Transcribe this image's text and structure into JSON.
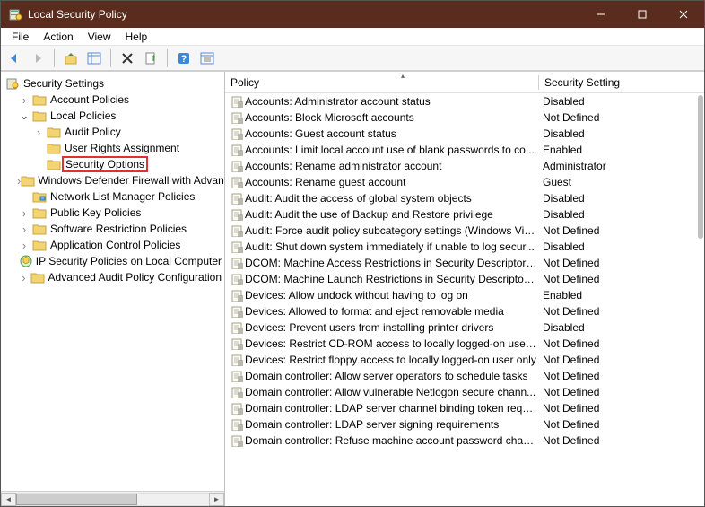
{
  "window": {
    "title": "Local Security Policy"
  },
  "menus": [
    "File",
    "Action",
    "View",
    "Help"
  ],
  "tree": {
    "root": "Security Settings",
    "root_expanded": true,
    "nodes": [
      {
        "label": "Account Policies",
        "indent": 1,
        "twisty": ">",
        "icon": "folder"
      },
      {
        "label": "Local Policies",
        "indent": 1,
        "twisty": "v",
        "icon": "folder"
      },
      {
        "label": "Audit Policy",
        "indent": 2,
        "twisty": ">",
        "icon": "folder"
      },
      {
        "label": "User Rights Assignment",
        "indent": 2,
        "twisty": "",
        "icon": "folder"
      },
      {
        "label": "Security Options",
        "indent": 2,
        "twisty": "",
        "icon": "folder",
        "highlight": true
      },
      {
        "label": "Windows Defender Firewall with Advanced Security",
        "indent": 1,
        "twisty": ">",
        "icon": "folder"
      },
      {
        "label": "Network List Manager Policies",
        "indent": 1,
        "twisty": "",
        "icon": "folder-net"
      },
      {
        "label": "Public Key Policies",
        "indent": 1,
        "twisty": ">",
        "icon": "folder"
      },
      {
        "label": "Software Restriction Policies",
        "indent": 1,
        "twisty": ">",
        "icon": "folder"
      },
      {
        "label": "Application Control Policies",
        "indent": 1,
        "twisty": ">",
        "icon": "folder"
      },
      {
        "label": "IP Security Policies on Local Computer",
        "indent": 1,
        "twisty": "",
        "icon": "ipsec"
      },
      {
        "label": "Advanced Audit Policy Configuration",
        "indent": 1,
        "twisty": ">",
        "icon": "folder"
      }
    ]
  },
  "columns": {
    "policy": "Policy",
    "setting": "Security Setting"
  },
  "policies": [
    {
      "name": "Accounts: Administrator account status",
      "setting": "Disabled"
    },
    {
      "name": "Accounts: Block Microsoft accounts",
      "setting": "Not Defined"
    },
    {
      "name": "Accounts: Guest account status",
      "setting": "Disabled"
    },
    {
      "name": "Accounts: Limit local account use of blank passwords to co...",
      "setting": "Enabled"
    },
    {
      "name": "Accounts: Rename administrator account",
      "setting": "Administrator"
    },
    {
      "name": "Accounts: Rename guest account",
      "setting": "Guest"
    },
    {
      "name": "Audit: Audit the access of global system objects",
      "setting": "Disabled"
    },
    {
      "name": "Audit: Audit the use of Backup and Restore privilege",
      "setting": "Disabled"
    },
    {
      "name": "Audit: Force audit policy subcategory settings (Windows Vis...",
      "setting": "Not Defined"
    },
    {
      "name": "Audit: Shut down system immediately if unable to log secur...",
      "setting": "Disabled"
    },
    {
      "name": "DCOM: Machine Access Restrictions in Security Descriptor D...",
      "setting": "Not Defined"
    },
    {
      "name": "DCOM: Machine Launch Restrictions in Security Descriptor ...",
      "setting": "Not Defined"
    },
    {
      "name": "Devices: Allow undock without having to log on",
      "setting": "Enabled"
    },
    {
      "name": "Devices: Allowed to format and eject removable media",
      "setting": "Not Defined"
    },
    {
      "name": "Devices: Prevent users from installing printer drivers",
      "setting": "Disabled"
    },
    {
      "name": "Devices: Restrict CD-ROM access to locally logged-on user ...",
      "setting": "Not Defined"
    },
    {
      "name": "Devices: Restrict floppy access to locally logged-on user only",
      "setting": "Not Defined"
    },
    {
      "name": "Domain controller: Allow server operators to schedule tasks",
      "setting": "Not Defined"
    },
    {
      "name": "Domain controller: Allow vulnerable Netlogon secure chann...",
      "setting": "Not Defined"
    },
    {
      "name": "Domain controller: LDAP server channel binding token requi...",
      "setting": "Not Defined"
    },
    {
      "name": "Domain controller: LDAP server signing requirements",
      "setting": "Not Defined"
    },
    {
      "name": "Domain controller: Refuse machine account password chan...",
      "setting": "Not Defined"
    }
  ]
}
